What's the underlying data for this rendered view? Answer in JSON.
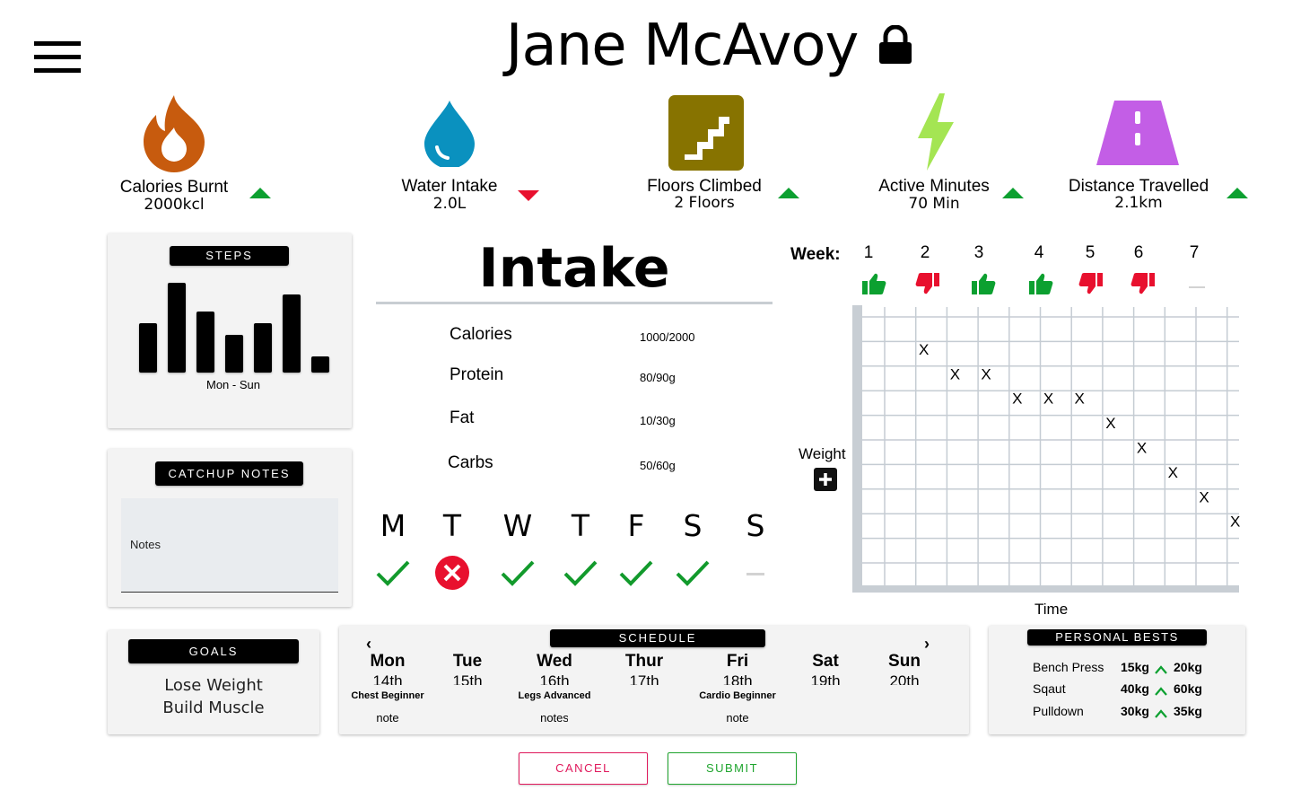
{
  "header": {
    "title": "Jane McAvoy",
    "menu_icon": "hamburger-menu-icon",
    "lock_icon": "lock-icon"
  },
  "stats": [
    {
      "label": "Calories Burnt",
      "value": "2000kcl",
      "icon": "flame-icon",
      "color": "#c75b0e",
      "trend": "up"
    },
    {
      "label": "Water Intake",
      "value": "2.0L",
      "icon": "water-drop-icon",
      "color": "#0a91bf",
      "trend": "down"
    },
    {
      "label": "Floors Climbed",
      "value": "2 Floors",
      "icon": "stairs-icon",
      "color": "#877300",
      "trend": "up"
    },
    {
      "label": "Active Minutes",
      "value": "70 Min",
      "icon": "lightning-icon",
      "color": "#a4e553",
      "trend": "up"
    },
    {
      "label": "Distance Travelled",
      "value": "2.1km",
      "icon": "road-icon",
      "color": "#c35ee6",
      "trend": "up"
    }
  ],
  "colors": {
    "up": "#0ca030",
    "down": "#e8102e",
    "check": "#129a2c"
  },
  "steps": {
    "title": "STEPS",
    "caption": "Mon - Sun",
    "values": [
      55,
      100,
      68,
      42,
      55,
      87,
      18
    ]
  },
  "notes": {
    "title": "CATCHUP NOTES",
    "placeholder": "Notes"
  },
  "goals": {
    "title": "GOALS",
    "items": [
      "Lose Weight",
      "Build Muscle"
    ]
  },
  "intake": {
    "title": "Intake",
    "rows": [
      {
        "label": "Calories",
        "value": "1000/2000"
      },
      {
        "label": "Protein",
        "value": "80/90g"
      },
      {
        "label": "Fat",
        "value": "10/30g"
      },
      {
        "label": "Carbs",
        "value": "50/60g"
      }
    ],
    "days": [
      {
        "letter": "M",
        "status": "done"
      },
      {
        "letter": "T",
        "status": "missed"
      },
      {
        "letter": "W",
        "status": "done"
      },
      {
        "letter": "T",
        "status": "done"
      },
      {
        "letter": "F",
        "status": "done"
      },
      {
        "letter": "S",
        "status": "done"
      },
      {
        "letter": "S",
        "status": "pending"
      }
    ]
  },
  "weeks": {
    "label": "Week:",
    "items": [
      {
        "n": "1",
        "status": "up"
      },
      {
        "n": "2",
        "status": "down"
      },
      {
        "n": "3",
        "status": "up"
      },
      {
        "n": "4",
        "status": "up"
      },
      {
        "n": "5",
        "status": "down"
      },
      {
        "n": "6",
        "status": "down"
      },
      {
        "n": "7",
        "status": "pending"
      }
    ]
  },
  "weight_chart": {
    "ylabel": "Weight",
    "xlabel": "Time",
    "marker": "X",
    "add_icon": "plus-icon"
  },
  "chart_data": {
    "type": "scatter",
    "xlabel": "Time",
    "ylabel": "Weight",
    "marker": "X",
    "x": [
      2,
      3,
      4,
      5,
      6,
      7,
      8,
      9,
      10,
      11,
      12
    ],
    "y": [
      10,
      9,
      9,
      8,
      8,
      8,
      7,
      6,
      5,
      4,
      3
    ],
    "xlim": [
      0,
      12
    ],
    "ylim": [
      0,
      11
    ],
    "grid": true
  },
  "schedule": {
    "title": "SCHEDULE",
    "days": [
      {
        "day": "Mon",
        "date": "14th",
        "workout": "Chest Beginner",
        "note": "note"
      },
      {
        "day": "Tue",
        "date": "15th",
        "workout": "",
        "note": ""
      },
      {
        "day": "Wed",
        "date": "16th",
        "workout": "Legs Advanced",
        "note": "notes"
      },
      {
        "day": "Thur",
        "date": "17th",
        "workout": "",
        "note": ""
      },
      {
        "day": "Fri",
        "date": "18th",
        "workout": "Cardio Beginner",
        "note": "note"
      },
      {
        "day": "Sat",
        "date": "19th",
        "workout": "",
        "note": ""
      },
      {
        "day": "Sun",
        "date": "20th",
        "workout": "",
        "note": ""
      }
    ]
  },
  "personal_bests": {
    "title": "PERSONAL BESTS",
    "rows": [
      {
        "exercise": "Bench Press",
        "from": "15kg",
        "to": "20kg"
      },
      {
        "exercise": "Sqaut",
        "from": "40kg",
        "to": "60kg"
      },
      {
        "exercise": "Pulldown",
        "from": "30kg",
        "to": "35kg"
      }
    ]
  },
  "actions": {
    "cancel": "CANCEL",
    "submit": "SUBMIT",
    "cancel_color": "#e0195c",
    "submit_color": "#1fa52e"
  }
}
